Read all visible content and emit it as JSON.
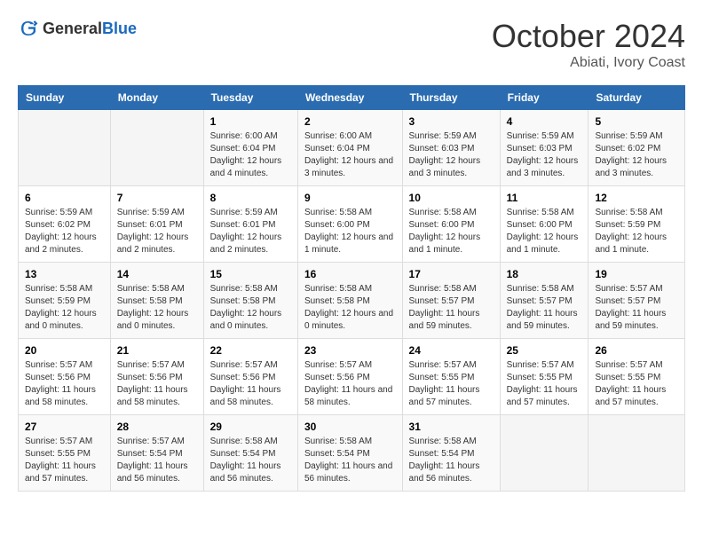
{
  "logo": {
    "general": "General",
    "blue": "Blue"
  },
  "header": {
    "month": "October 2024",
    "location": "Abiati, Ivory Coast"
  },
  "weekdays": [
    "Sunday",
    "Monday",
    "Tuesday",
    "Wednesday",
    "Thursday",
    "Friday",
    "Saturday"
  ],
  "weeks": [
    [
      {
        "day": "",
        "info": ""
      },
      {
        "day": "",
        "info": ""
      },
      {
        "day": "1",
        "info": "Sunrise: 6:00 AM\nSunset: 6:04 PM\nDaylight: 12 hours and 4 minutes."
      },
      {
        "day": "2",
        "info": "Sunrise: 6:00 AM\nSunset: 6:04 PM\nDaylight: 12 hours and 3 minutes."
      },
      {
        "day": "3",
        "info": "Sunrise: 5:59 AM\nSunset: 6:03 PM\nDaylight: 12 hours and 3 minutes."
      },
      {
        "day": "4",
        "info": "Sunrise: 5:59 AM\nSunset: 6:03 PM\nDaylight: 12 hours and 3 minutes."
      },
      {
        "day": "5",
        "info": "Sunrise: 5:59 AM\nSunset: 6:02 PM\nDaylight: 12 hours and 3 minutes."
      }
    ],
    [
      {
        "day": "6",
        "info": "Sunrise: 5:59 AM\nSunset: 6:02 PM\nDaylight: 12 hours and 2 minutes."
      },
      {
        "day": "7",
        "info": "Sunrise: 5:59 AM\nSunset: 6:01 PM\nDaylight: 12 hours and 2 minutes."
      },
      {
        "day": "8",
        "info": "Sunrise: 5:59 AM\nSunset: 6:01 PM\nDaylight: 12 hours and 2 minutes."
      },
      {
        "day": "9",
        "info": "Sunrise: 5:58 AM\nSunset: 6:00 PM\nDaylight: 12 hours and 1 minute."
      },
      {
        "day": "10",
        "info": "Sunrise: 5:58 AM\nSunset: 6:00 PM\nDaylight: 12 hours and 1 minute."
      },
      {
        "day": "11",
        "info": "Sunrise: 5:58 AM\nSunset: 6:00 PM\nDaylight: 12 hours and 1 minute."
      },
      {
        "day": "12",
        "info": "Sunrise: 5:58 AM\nSunset: 5:59 PM\nDaylight: 12 hours and 1 minute."
      }
    ],
    [
      {
        "day": "13",
        "info": "Sunrise: 5:58 AM\nSunset: 5:59 PM\nDaylight: 12 hours and 0 minutes."
      },
      {
        "day": "14",
        "info": "Sunrise: 5:58 AM\nSunset: 5:58 PM\nDaylight: 12 hours and 0 minutes."
      },
      {
        "day": "15",
        "info": "Sunrise: 5:58 AM\nSunset: 5:58 PM\nDaylight: 12 hours and 0 minutes."
      },
      {
        "day": "16",
        "info": "Sunrise: 5:58 AM\nSunset: 5:58 PM\nDaylight: 12 hours and 0 minutes."
      },
      {
        "day": "17",
        "info": "Sunrise: 5:58 AM\nSunset: 5:57 PM\nDaylight: 11 hours and 59 minutes."
      },
      {
        "day": "18",
        "info": "Sunrise: 5:58 AM\nSunset: 5:57 PM\nDaylight: 11 hours and 59 minutes."
      },
      {
        "day": "19",
        "info": "Sunrise: 5:57 AM\nSunset: 5:57 PM\nDaylight: 11 hours and 59 minutes."
      }
    ],
    [
      {
        "day": "20",
        "info": "Sunrise: 5:57 AM\nSunset: 5:56 PM\nDaylight: 11 hours and 58 minutes."
      },
      {
        "day": "21",
        "info": "Sunrise: 5:57 AM\nSunset: 5:56 PM\nDaylight: 11 hours and 58 minutes."
      },
      {
        "day": "22",
        "info": "Sunrise: 5:57 AM\nSunset: 5:56 PM\nDaylight: 11 hours and 58 minutes."
      },
      {
        "day": "23",
        "info": "Sunrise: 5:57 AM\nSunset: 5:56 PM\nDaylight: 11 hours and 58 minutes."
      },
      {
        "day": "24",
        "info": "Sunrise: 5:57 AM\nSunset: 5:55 PM\nDaylight: 11 hours and 57 minutes."
      },
      {
        "day": "25",
        "info": "Sunrise: 5:57 AM\nSunset: 5:55 PM\nDaylight: 11 hours and 57 minutes."
      },
      {
        "day": "26",
        "info": "Sunrise: 5:57 AM\nSunset: 5:55 PM\nDaylight: 11 hours and 57 minutes."
      }
    ],
    [
      {
        "day": "27",
        "info": "Sunrise: 5:57 AM\nSunset: 5:55 PM\nDaylight: 11 hours and 57 minutes."
      },
      {
        "day": "28",
        "info": "Sunrise: 5:57 AM\nSunset: 5:54 PM\nDaylight: 11 hours and 56 minutes."
      },
      {
        "day": "29",
        "info": "Sunrise: 5:58 AM\nSunset: 5:54 PM\nDaylight: 11 hours and 56 minutes."
      },
      {
        "day": "30",
        "info": "Sunrise: 5:58 AM\nSunset: 5:54 PM\nDaylight: 11 hours and 56 minutes."
      },
      {
        "day": "31",
        "info": "Sunrise: 5:58 AM\nSunset: 5:54 PM\nDaylight: 11 hours and 56 minutes."
      },
      {
        "day": "",
        "info": ""
      },
      {
        "day": "",
        "info": ""
      }
    ]
  ]
}
